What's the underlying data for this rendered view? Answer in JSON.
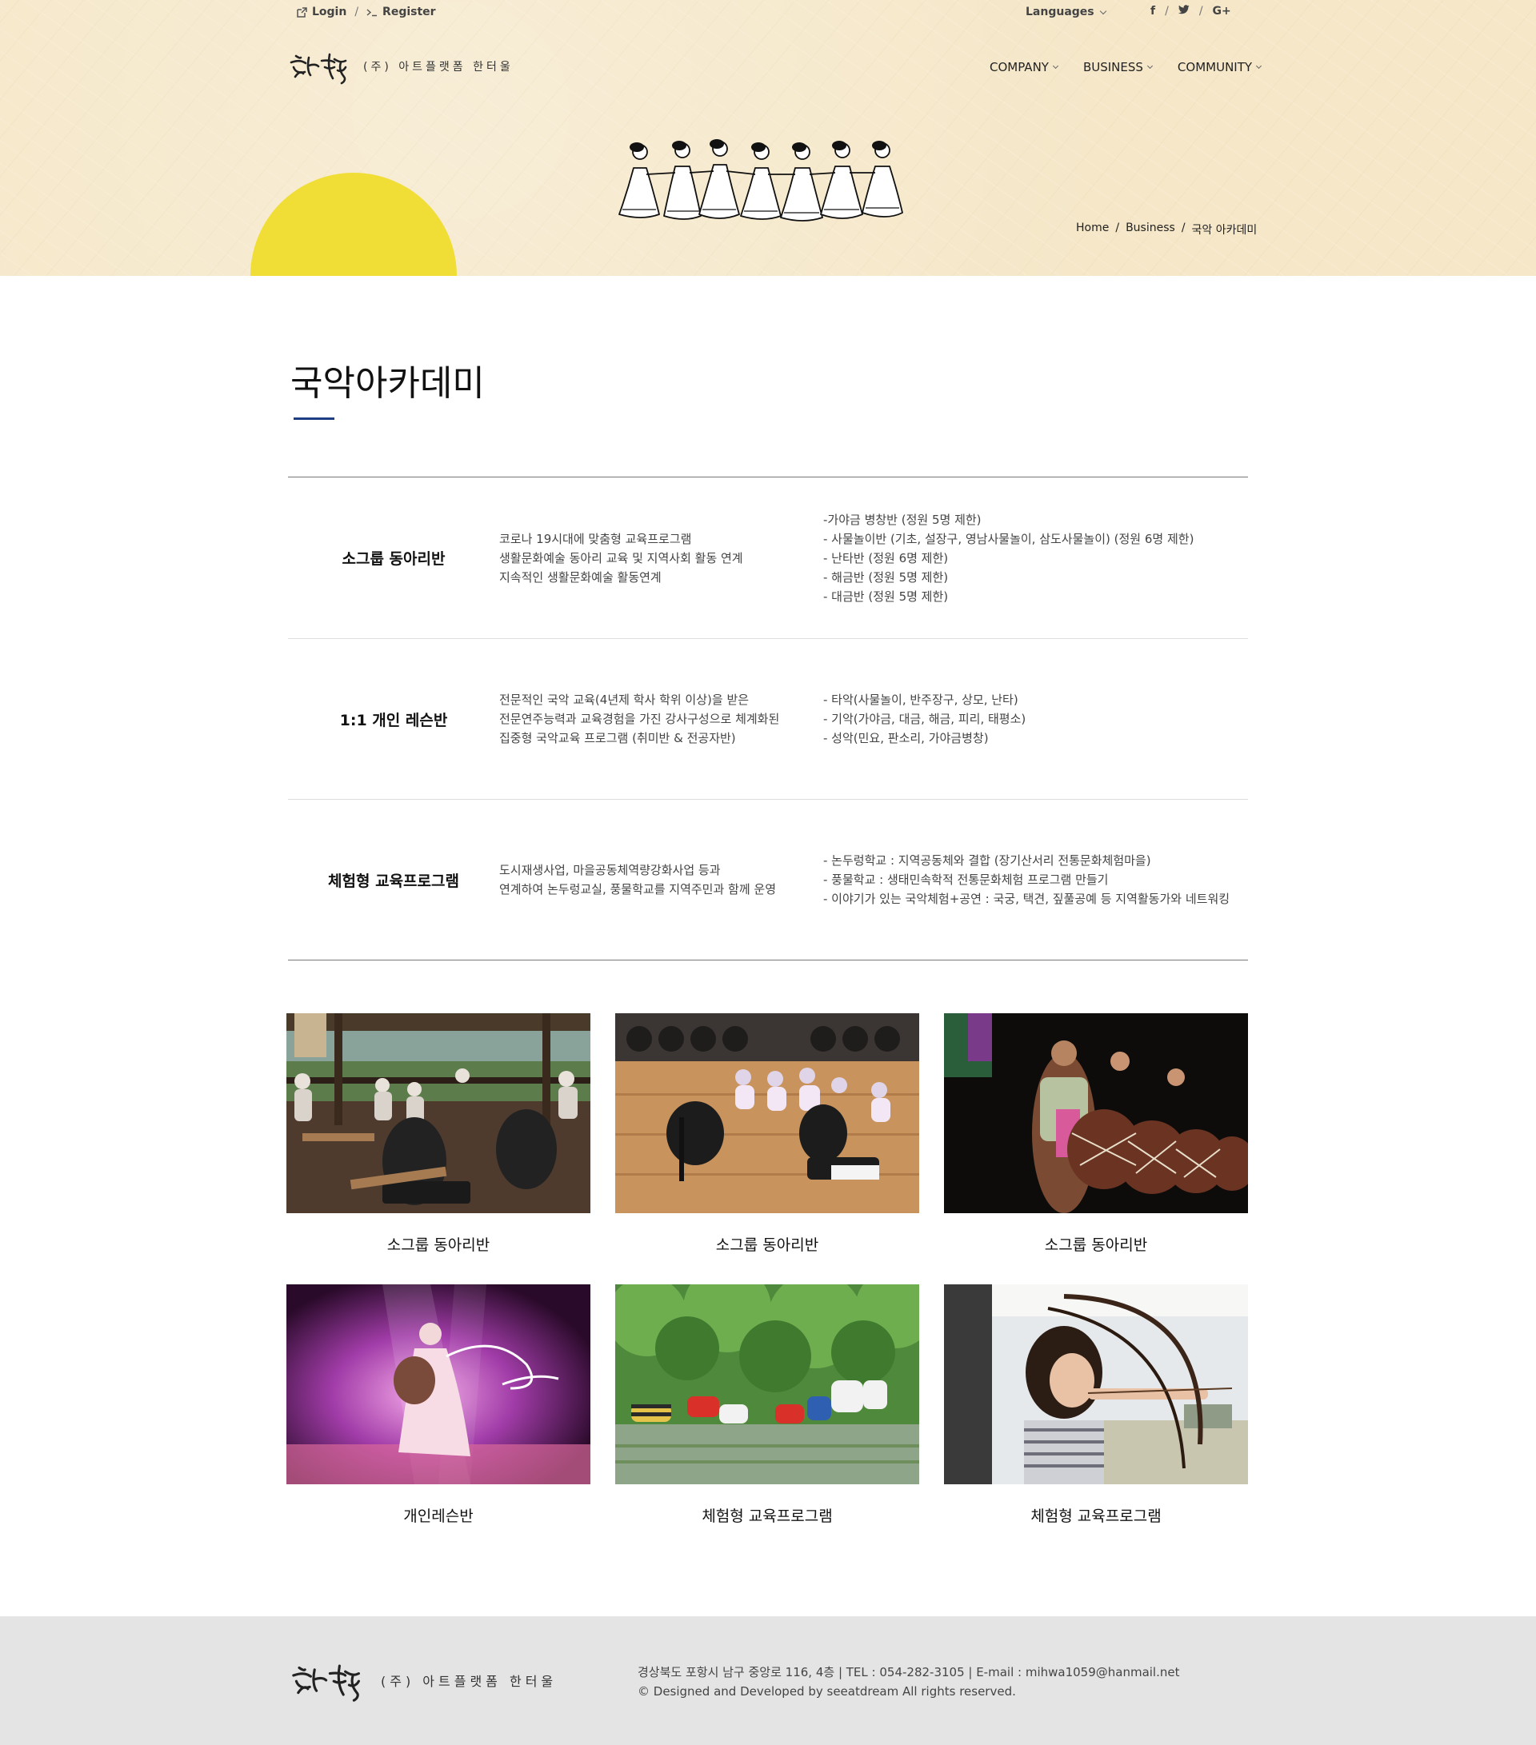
{
  "topbar": {
    "login": "Login",
    "separator": "/",
    "register": "Register",
    "languages": "Languages",
    "social": [
      "f",
      "/",
      "t",
      "/",
      "G+"
    ]
  },
  "logo": {
    "brand_mark": "한터울",
    "text": "(주) 아트플랫폼 한터울"
  },
  "nav": {
    "items": [
      "COMPANY",
      "BUSINESS",
      "COMMUNITY"
    ]
  },
  "breadcrumb": {
    "home": "Home",
    "sep": "/",
    "business": "Business",
    "current": "국악 아카데미"
  },
  "page": {
    "title": "국악아카데미"
  },
  "programs": [
    {
      "name": "소그룹 동아리반",
      "desc": [
        "코로나 19시대에 맞춤형 교육프로그램",
        "생활문화예술 동아리 교육 및 지역사회 활동 연계",
        "지속적인 생활문화예술 활동연계"
      ],
      "details": [
        "-가야금 병창반 (정원 5명 제한)",
        "- 사물놀이반 (기초, 설장구, 영남사물놀이, 삼도사물놀이) (정원 6명 제한)",
        "- 난타반 (정원 6명 제한)",
        "- 해금반 (정원 5명 제한)",
        "- 대금반 (정원 5명 제한)"
      ]
    },
    {
      "name": "1:1 개인 레슨반",
      "desc": [
        "전문적인 국악 교육(4년제 학사 학위 이상)을 받은",
        "전문연주능력과 교육경험을 가진 강사구성으로 체계화된",
        "집중형 국악교육 프로그램 (취미반 & 전공자반)"
      ],
      "details": [
        "- 타악(사물놀이, 반주장구, 상모, 난타)",
        "- 기악(가야금, 대금, 해금, 피리, 태평소)",
        "- 성악(민요, 판소리, 가야금병창)"
      ]
    },
    {
      "name": "체험형 교육프로그램",
      "desc": [
        "도시재생사업, 마을공동체역량강화사업 등과",
        "연계하여 논두렁교실, 풍물학교를 지역주민과 함께 운영"
      ],
      "details": [
        "- 논두렁학교 : 지역공동체와 결합 (장기산서리 전통문화체험마을)",
        "- 풍물학교 : 생태민속학적 전통문화체험 프로그램 만들기",
        "- 이야기가 있는 국악체험+공연 : 국궁, 택견, 짚풀공예 등 지역활동가와 네트워킹"
      ]
    }
  ],
  "gallery": [
    {
      "caption": "소그룹 동아리반",
      "scene": "gayageum-pavilion"
    },
    {
      "caption": "소그룹 동아리반",
      "scene": "haegeum-class"
    },
    {
      "caption": "소그룹 동아리반",
      "scene": "drum-performance"
    },
    {
      "caption": "개인레슨반",
      "scene": "stage-dance"
    },
    {
      "caption": "체험형 교육프로그램",
      "scene": "rice-planting"
    },
    {
      "caption": "체험형 교육프로그램",
      "scene": "archery"
    }
  ],
  "footer": {
    "logo_text": "(주) 아트플랫폼 한터울",
    "address_line": "경상북도 포항시 남구 중앙로 116, 4층  |  TEL : 054-282-3105  |  E-mail : mihwa1059@hanmail.net",
    "copyright": "© Designed and Developed by seeatdream  All rights reserved."
  },
  "colors": {
    "header_bg": "#f5e7c8",
    "sun": "#f0de36",
    "title_accent": "#1d3e84",
    "footer_bg": "#e4e4e4"
  }
}
